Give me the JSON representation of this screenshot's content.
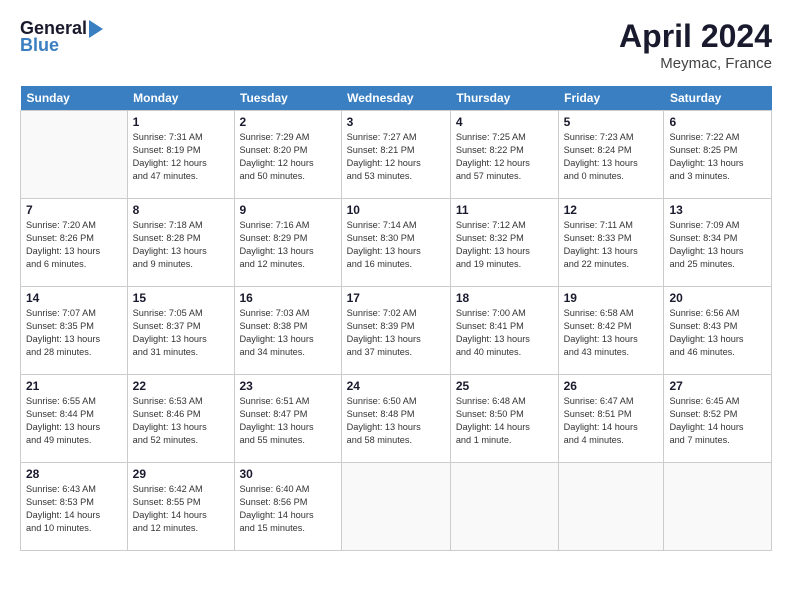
{
  "header": {
    "logo_line1": "General",
    "logo_line2": "Blue",
    "month_year": "April 2024",
    "location": "Meymac, France"
  },
  "weekdays": [
    "Sunday",
    "Monday",
    "Tuesday",
    "Wednesday",
    "Thursday",
    "Friday",
    "Saturday"
  ],
  "weeks": [
    [
      {
        "num": "",
        "info": ""
      },
      {
        "num": "1",
        "info": "Sunrise: 7:31 AM\nSunset: 8:19 PM\nDaylight: 12 hours\nand 47 minutes."
      },
      {
        "num": "2",
        "info": "Sunrise: 7:29 AM\nSunset: 8:20 PM\nDaylight: 12 hours\nand 50 minutes."
      },
      {
        "num": "3",
        "info": "Sunrise: 7:27 AM\nSunset: 8:21 PM\nDaylight: 12 hours\nand 53 minutes."
      },
      {
        "num": "4",
        "info": "Sunrise: 7:25 AM\nSunset: 8:22 PM\nDaylight: 12 hours\nand 57 minutes."
      },
      {
        "num": "5",
        "info": "Sunrise: 7:23 AM\nSunset: 8:24 PM\nDaylight: 13 hours\nand 0 minutes."
      },
      {
        "num": "6",
        "info": "Sunrise: 7:22 AM\nSunset: 8:25 PM\nDaylight: 13 hours\nand 3 minutes."
      }
    ],
    [
      {
        "num": "7",
        "info": "Sunrise: 7:20 AM\nSunset: 8:26 PM\nDaylight: 13 hours\nand 6 minutes."
      },
      {
        "num": "8",
        "info": "Sunrise: 7:18 AM\nSunset: 8:28 PM\nDaylight: 13 hours\nand 9 minutes."
      },
      {
        "num": "9",
        "info": "Sunrise: 7:16 AM\nSunset: 8:29 PM\nDaylight: 13 hours\nand 12 minutes."
      },
      {
        "num": "10",
        "info": "Sunrise: 7:14 AM\nSunset: 8:30 PM\nDaylight: 13 hours\nand 16 minutes."
      },
      {
        "num": "11",
        "info": "Sunrise: 7:12 AM\nSunset: 8:32 PM\nDaylight: 13 hours\nand 19 minutes."
      },
      {
        "num": "12",
        "info": "Sunrise: 7:11 AM\nSunset: 8:33 PM\nDaylight: 13 hours\nand 22 minutes."
      },
      {
        "num": "13",
        "info": "Sunrise: 7:09 AM\nSunset: 8:34 PM\nDaylight: 13 hours\nand 25 minutes."
      }
    ],
    [
      {
        "num": "14",
        "info": "Sunrise: 7:07 AM\nSunset: 8:35 PM\nDaylight: 13 hours\nand 28 minutes."
      },
      {
        "num": "15",
        "info": "Sunrise: 7:05 AM\nSunset: 8:37 PM\nDaylight: 13 hours\nand 31 minutes."
      },
      {
        "num": "16",
        "info": "Sunrise: 7:03 AM\nSunset: 8:38 PM\nDaylight: 13 hours\nand 34 minutes."
      },
      {
        "num": "17",
        "info": "Sunrise: 7:02 AM\nSunset: 8:39 PM\nDaylight: 13 hours\nand 37 minutes."
      },
      {
        "num": "18",
        "info": "Sunrise: 7:00 AM\nSunset: 8:41 PM\nDaylight: 13 hours\nand 40 minutes."
      },
      {
        "num": "19",
        "info": "Sunrise: 6:58 AM\nSunset: 8:42 PM\nDaylight: 13 hours\nand 43 minutes."
      },
      {
        "num": "20",
        "info": "Sunrise: 6:56 AM\nSunset: 8:43 PM\nDaylight: 13 hours\nand 46 minutes."
      }
    ],
    [
      {
        "num": "21",
        "info": "Sunrise: 6:55 AM\nSunset: 8:44 PM\nDaylight: 13 hours\nand 49 minutes."
      },
      {
        "num": "22",
        "info": "Sunrise: 6:53 AM\nSunset: 8:46 PM\nDaylight: 13 hours\nand 52 minutes."
      },
      {
        "num": "23",
        "info": "Sunrise: 6:51 AM\nSunset: 8:47 PM\nDaylight: 13 hours\nand 55 minutes."
      },
      {
        "num": "24",
        "info": "Sunrise: 6:50 AM\nSunset: 8:48 PM\nDaylight: 13 hours\nand 58 minutes."
      },
      {
        "num": "25",
        "info": "Sunrise: 6:48 AM\nSunset: 8:50 PM\nDaylight: 14 hours\nand 1 minute."
      },
      {
        "num": "26",
        "info": "Sunrise: 6:47 AM\nSunset: 8:51 PM\nDaylight: 14 hours\nand 4 minutes."
      },
      {
        "num": "27",
        "info": "Sunrise: 6:45 AM\nSunset: 8:52 PM\nDaylight: 14 hours\nand 7 minutes."
      }
    ],
    [
      {
        "num": "28",
        "info": "Sunrise: 6:43 AM\nSunset: 8:53 PM\nDaylight: 14 hours\nand 10 minutes."
      },
      {
        "num": "29",
        "info": "Sunrise: 6:42 AM\nSunset: 8:55 PM\nDaylight: 14 hours\nand 12 minutes."
      },
      {
        "num": "30",
        "info": "Sunrise: 6:40 AM\nSunset: 8:56 PM\nDaylight: 14 hours\nand 15 minutes."
      },
      {
        "num": "",
        "info": ""
      },
      {
        "num": "",
        "info": ""
      },
      {
        "num": "",
        "info": ""
      },
      {
        "num": "",
        "info": ""
      }
    ]
  ]
}
